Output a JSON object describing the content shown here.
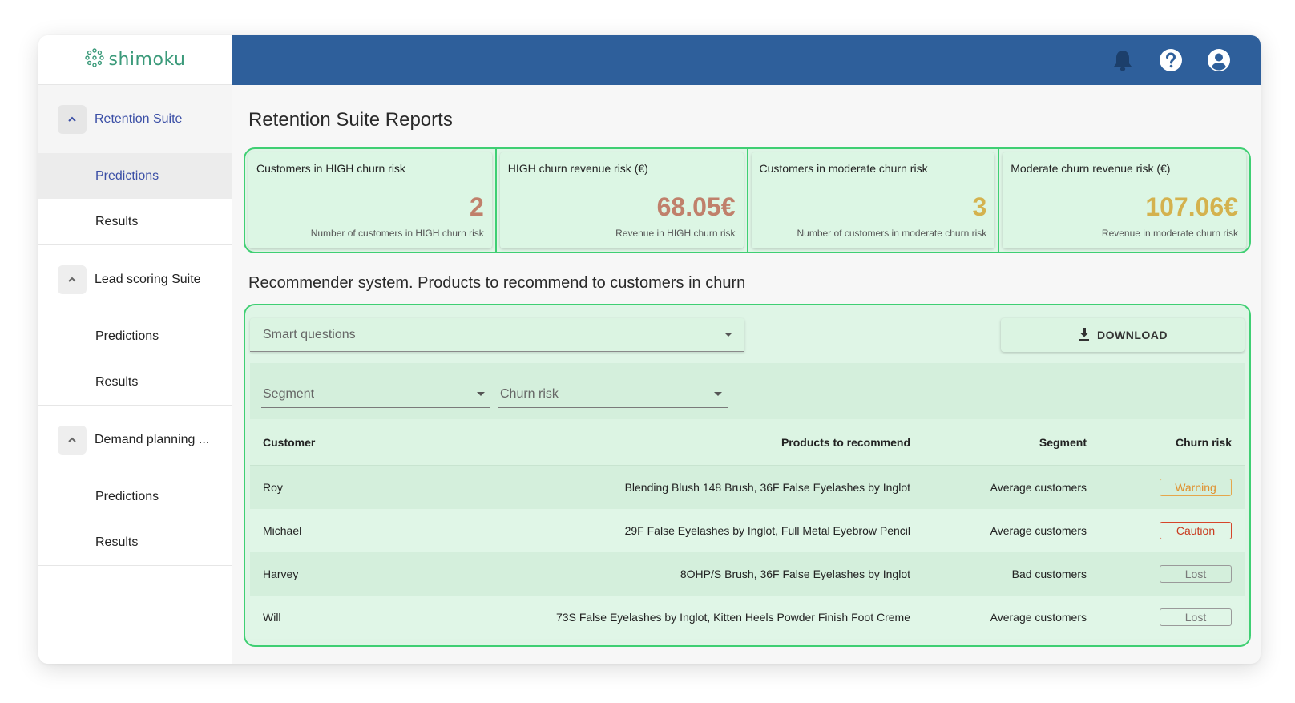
{
  "app": {
    "logo_text": "shimoku"
  },
  "sidebar": {
    "suites": [
      {
        "label": "Retention Suite",
        "active": true,
        "items": [
          {
            "label": "Predictions",
            "selected": true
          },
          {
            "label": "Results",
            "selected": false
          }
        ]
      },
      {
        "label": "Lead scoring Suite",
        "active": false,
        "items": [
          {
            "label": "Predictions",
            "selected": false
          },
          {
            "label": "Results",
            "selected": false
          }
        ]
      },
      {
        "label": "Demand planning ...",
        "active": false,
        "items": [
          {
            "label": "Predictions",
            "selected": false
          },
          {
            "label": "Results",
            "selected": false
          }
        ]
      }
    ]
  },
  "header": {
    "icons": [
      "bell-icon",
      "help-icon",
      "account-icon"
    ],
    "color": "#2e5f9b"
  },
  "main": {
    "title": "Retention Suite Reports",
    "kpis": [
      {
        "title": "Customers in HIGH churn risk",
        "value": "2",
        "description": "Number of customers in HIGH churn risk",
        "color": "#c0806b"
      },
      {
        "title": "HIGH churn revenue risk (€)",
        "value": "68.05€",
        "description": "Revenue in HIGH churn risk",
        "color": "#c0806b"
      },
      {
        "title": "Customers in moderate churn risk",
        "value": "3",
        "description": "Number of customers in moderate churn risk",
        "color": "#d4b24e"
      },
      {
        "title": "Moderate churn revenue risk (€)",
        "value": "107.06€",
        "description": "Revenue in moderate churn risk",
        "color": "#d4b24e"
      }
    ],
    "section_title": "Recommender system. Products to recommend to customers in churn",
    "smart_questions_label": "Smart questions",
    "download_label": "DOWNLOAD",
    "filters": {
      "segment_label": "Segment",
      "churn_label": "Churn risk"
    },
    "table": {
      "headers": {
        "customer": "Customer",
        "products": "Products to recommend",
        "segment": "Segment",
        "churn": "Churn risk"
      },
      "rows": [
        {
          "customer": "Roy",
          "products": "Blending Blush 148 Brush, 36F False Eyelashes by Inglot",
          "segment": "Average customers",
          "churn": "Warning",
          "churn_type": "warning"
        },
        {
          "customer": "Michael",
          "products": "29F False Eyelashes by Inglot, Full Metal Eyebrow Pencil",
          "segment": "Average customers",
          "churn": "Caution",
          "churn_type": "caution"
        },
        {
          "customer": "Harvey",
          "products": "8OHP/S Brush, 36F False Eyelashes by Inglot",
          "segment": "Bad customers",
          "churn": "Lost",
          "churn_type": "lost"
        },
        {
          "customer": "Will",
          "products": "73S False Eyelashes by Inglot, Kitten Heels Powder Finish Foot Creme",
          "segment": "Average customers",
          "churn": "Lost",
          "churn_type": "lost"
        }
      ]
    }
  },
  "colors": {
    "accent_green": "#3fcf73",
    "panel_green": "#dff5e6",
    "active_blue": "#3b4fa6",
    "warning": "#e08f2c",
    "caution": "#c93b1f",
    "lost": "#7a7a7a"
  }
}
